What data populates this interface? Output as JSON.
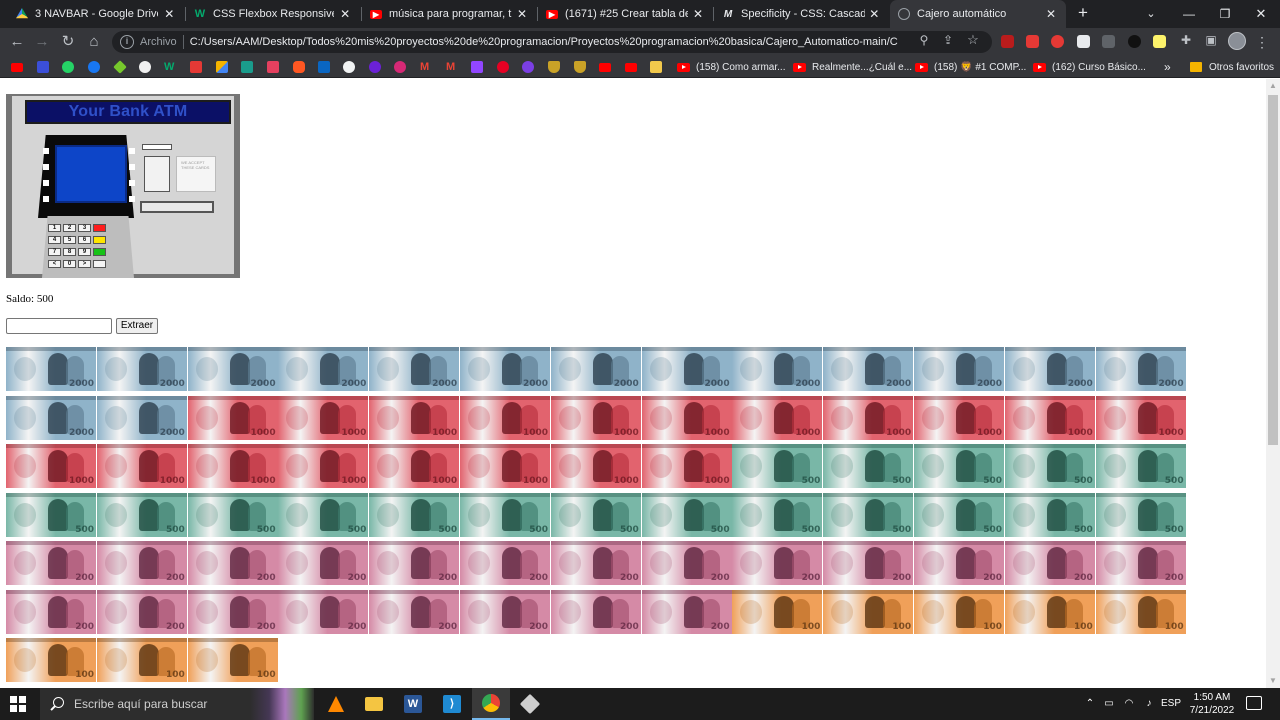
{
  "tabs": [
    {
      "title": "3 NAVBAR - Google Drive",
      "icon": "google-drive-icon",
      "color": "#1fa463"
    },
    {
      "title": "CSS Flexbox Responsive",
      "icon": "w3schools-icon",
      "color": "#04aa6d"
    },
    {
      "title": "música para programar, traba",
      "icon": "youtube-icon",
      "color": "#ff0000"
    },
    {
      "title": "(1671) #25 Crear tabla de pre",
      "icon": "youtube-icon",
      "color": "#ff0000"
    },
    {
      "title": "Specificity - CSS: Cascading S",
      "icon": "mdn-icon",
      "color": "#000000"
    },
    {
      "title": "Cajero automático",
      "icon": "globe-icon",
      "color": "#9aa0a6",
      "active": true
    }
  ],
  "toolbar": {
    "scheme": "Archivo",
    "url": "C:/Users/AAM/Desktop/Todos%20mis%20proyectos%20de%20programacion/Proyectos%20programacion%20basica/Cajero_Automatico-main/C..."
  },
  "bookmarks": {
    "named": [
      {
        "label": "(158) Como armar..."
      },
      {
        "label": "Realmente...¿Cuál e..."
      },
      {
        "label": "(158) 🦁 #1 COMP..."
      },
      {
        "label": "(162) Curso Básico..."
      }
    ],
    "more": "»",
    "folder": "Otros favoritos"
  },
  "page": {
    "atm_title": "Your Bank ATM",
    "atm_sticker": "WE ACCEPT THESE CARDS",
    "saldo": "Saldo: 500",
    "input_value": "",
    "button_label": "Extraer",
    "keypad": [
      "1",
      "2",
      "3",
      "",
      "4",
      "5",
      "6",
      "",
      "7",
      "8",
      "9",
      "",
      "<",
      "0",
      ">",
      ""
    ],
    "notes": [
      {
        "denom": "2000",
        "count": 15
      },
      {
        "denom": "1000",
        "count": 19
      },
      {
        "denom": "500",
        "count": 18
      },
      {
        "denom": "200",
        "count": 21
      },
      {
        "denom": "100",
        "count": 8
      }
    ]
  },
  "colors": {
    "note_2000": "#8fb3c9",
    "note_1000": "#e2636e",
    "note_500": "#79b7a7",
    "note_200": "#d58aa6",
    "note_100": "#f0a059"
  },
  "taskbar": {
    "search_placeholder": "Escribe aquí para buscar",
    "language": "ESP",
    "time": "1:50 AM",
    "date": "7/21/2022"
  }
}
